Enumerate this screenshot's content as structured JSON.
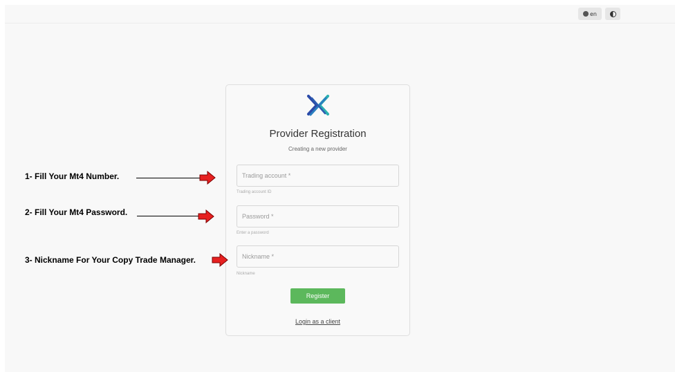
{
  "topbar": {
    "language_label": "en",
    "language_icon": "globe-icon",
    "theme_icon": "contrast-icon"
  },
  "form": {
    "title": "Provider Registration",
    "subtitle": "Creating a new provider",
    "trading_account": {
      "placeholder": "Trading account *",
      "helper": "Trading account ID"
    },
    "password": {
      "placeholder": "Password *",
      "helper": "Enter a password"
    },
    "nickname": {
      "placeholder": "Nickname *",
      "helper": "Nickname"
    },
    "register_label": "Register",
    "login_label": "Login as a client"
  },
  "annotations": [
    {
      "text": "1- Fill Your Mt4 Number."
    },
    {
      "text": "2- Fill Your Mt4 Password."
    },
    {
      "text": "3- Nickname For Your Copy Trade Manager."
    }
  ],
  "colors": {
    "register_button": "#5cb85c",
    "annotation_arrow": "#e62020",
    "logo_blue": "#2b4aa8",
    "logo_teal": "#2ab0b0"
  }
}
